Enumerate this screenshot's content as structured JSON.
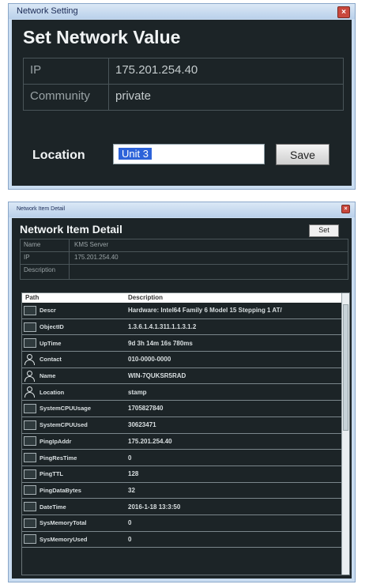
{
  "window1": {
    "title": "Network Setting",
    "close": "×",
    "heading": "Set Network Value",
    "fields": [
      {
        "label": "IP",
        "value": "175.201.254.40"
      },
      {
        "label": "Community",
        "value": "private"
      }
    ],
    "location_label": "Location",
    "location_value": "Unit 3",
    "save_label": "Save"
  },
  "window2": {
    "title": "Network Item Detail",
    "close": "×",
    "heading": "Network Item Detail",
    "set_label": "Set",
    "details": [
      {
        "label": "Name",
        "value": "KMS Server"
      },
      {
        "label": "IP",
        "value": "175.201.254.40"
      },
      {
        "label": "Description",
        "value": ""
      }
    ],
    "columns": [
      "Path",
      "Description"
    ],
    "rows": [
      {
        "icon": "box",
        "path": "Descr",
        "value": "Hardware: Intel64 Family 6 Model 15 Stepping 1 AT/"
      },
      {
        "icon": "box",
        "path": "ObjectID",
        "value": "1.3.6.1.4.1.311.1.1.3.1.2"
      },
      {
        "icon": "box",
        "path": "UpTime",
        "value": "9d 3h 14m 16s 780ms"
      },
      {
        "icon": "person",
        "path": "Contact",
        "value": "010-0000-0000"
      },
      {
        "icon": "person",
        "path": "Name",
        "value": "WIN-7QUKSR5RAD"
      },
      {
        "icon": "person",
        "path": "Location",
        "value": "stamp"
      },
      {
        "icon": "box",
        "path": "SystemCPUUsage",
        "value": "1705827840"
      },
      {
        "icon": "box",
        "path": "SystemCPUUsed",
        "value": "30623471"
      },
      {
        "icon": "box",
        "path": "PingIpAddr",
        "value": "175.201.254.40"
      },
      {
        "icon": "box",
        "path": "PingResTime",
        "value": "0"
      },
      {
        "icon": "box",
        "path": "PingTTL",
        "value": "128"
      },
      {
        "icon": "box",
        "path": "PingDataBytes",
        "value": "32"
      },
      {
        "icon": "box",
        "path": "DateTime",
        "value": "2016-1-18 13:3:50"
      },
      {
        "icon": "box",
        "path": "SysMemoryTotal",
        "value": "0"
      },
      {
        "icon": "box",
        "path": "SysMemoryUsed",
        "value": "0"
      }
    ]
  }
}
